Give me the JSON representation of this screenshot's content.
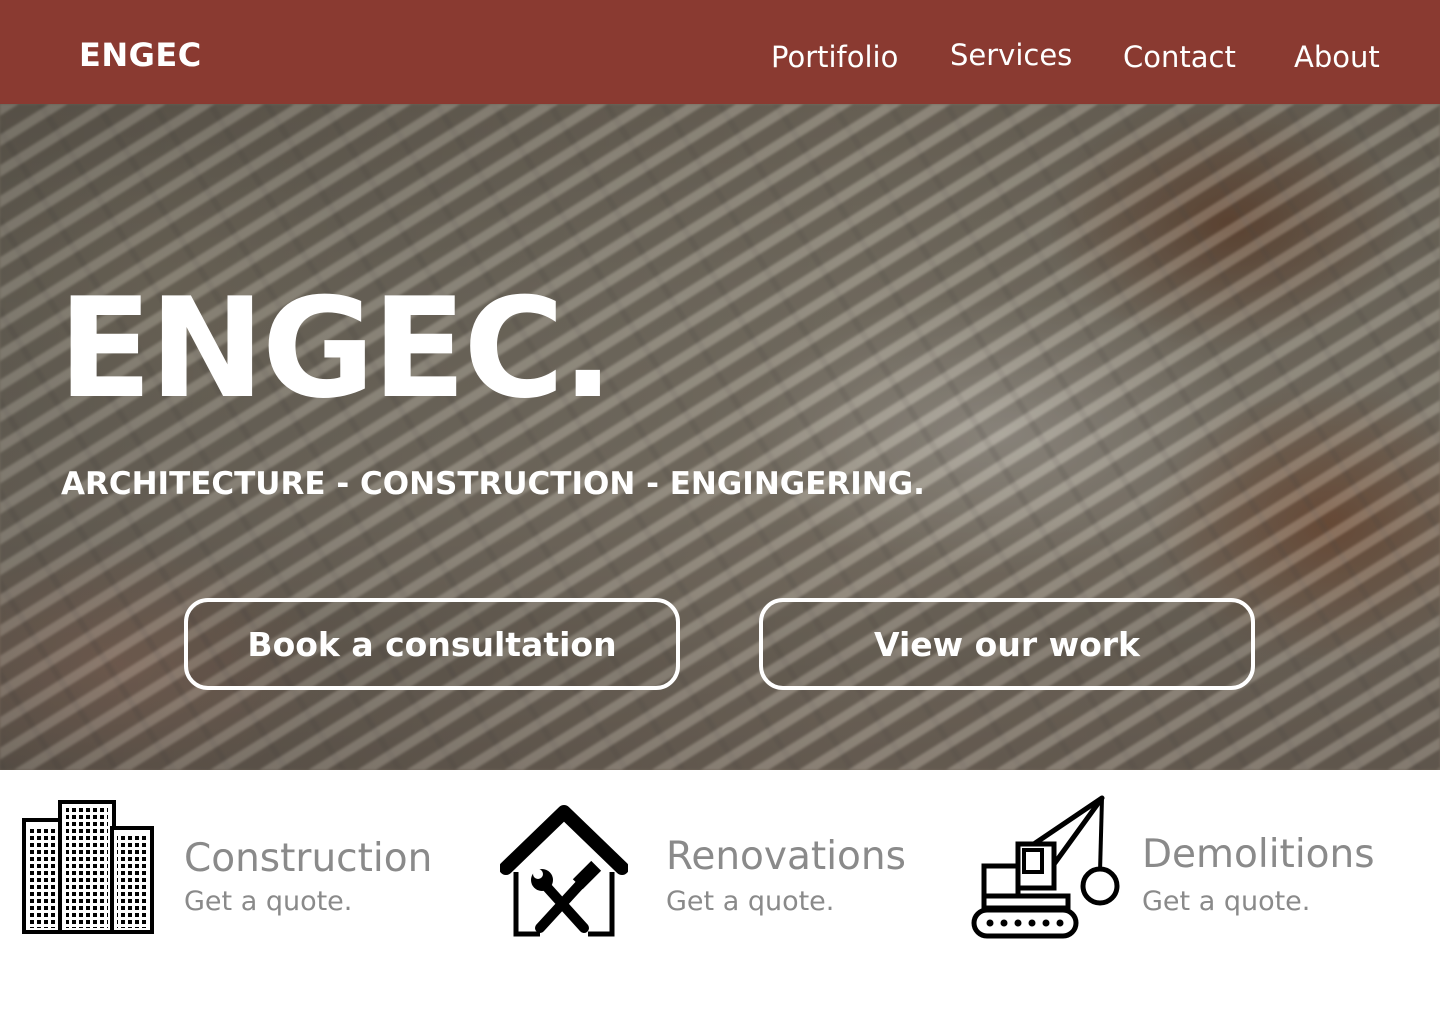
{
  "header": {
    "brand": "ENGEC",
    "nav": [
      {
        "label": "Portifolio"
      },
      {
        "label": "Services"
      },
      {
        "label": "Contact"
      },
      {
        "label": "About"
      }
    ]
  },
  "hero": {
    "title": "ENGEC.",
    "subtitle": "ARCHITECTURE - CONSTRUCTION - ENGINGERING.",
    "buttons": [
      {
        "label": "Book a consultation"
      },
      {
        "label": "View our work"
      }
    ]
  },
  "services": [
    {
      "title": "Construction",
      "subtitle": "Get a quote.",
      "icon": "buildings-icon"
    },
    {
      "title": "Renovations",
      "subtitle": "Get a quote.",
      "icon": "house-tools-icon"
    },
    {
      "title": "Demolitions",
      "subtitle": "Get a quote.",
      "icon": "wrecking-crane-icon"
    }
  ],
  "colors": {
    "header_bg": "#8a3a31",
    "service_text": "#8a8a8a"
  }
}
